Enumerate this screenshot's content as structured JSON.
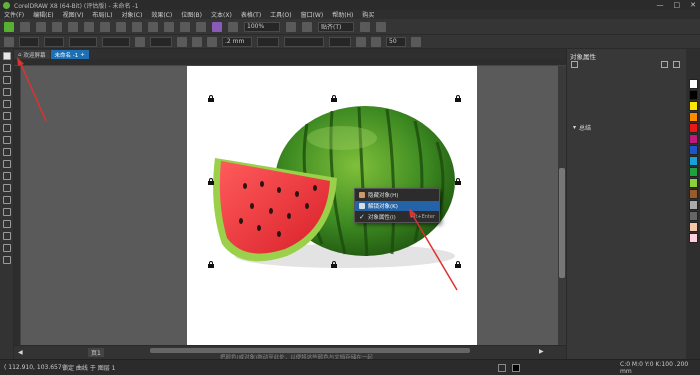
{
  "window": {
    "title": "CorelDRAW X8 (64-Bit) (评估版) - 未命名 -1",
    "controls": [
      "—",
      "□",
      "✕"
    ]
  },
  "menu": [
    "文件(F)",
    "编辑(E)",
    "视图(V)",
    "布局(L)",
    "对象(C)",
    "效果(C)",
    "位图(B)",
    "文本(X)",
    "表格(T)",
    "工具(O)",
    "窗口(W)",
    "帮助(H)",
    "购买"
  ],
  "toolbar": {
    "zoom": "100%",
    "snap": "贴齐(T)",
    "outline_width": ".2 mm",
    "size_value": "50"
  },
  "tabs": [
    {
      "label": "欢迎屏幕"
    },
    {
      "label": "未命名 -1"
    }
  ],
  "context_menu": {
    "items": [
      {
        "label": "隐藏对象(H)",
        "shortcut": ""
      },
      {
        "label": "解锁对象(K)",
        "shortcut": ""
      },
      {
        "label": "对象属性(I)",
        "shortcut": "Alt+Enter"
      }
    ]
  },
  "panel": {
    "title": "对象属性",
    "group_label": "总结"
  },
  "page_tab": "页1",
  "status": {
    "coords": "( 112.910, 103.657 )",
    "selection": "锁定 曲线 于 图层 1",
    "fill_info": "C:0 M:0 Y:0 K:100 .200 mm"
  },
  "canvas_hint": "把颜色(或对象)拖动至此处，以便将这些颜色与文档存储在一起",
  "palette": [
    "#ffffff",
    "#000000",
    "#ffe600",
    "#ff8a00",
    "#e81818",
    "#c2187a",
    "#2255c4",
    "#1aa0d8",
    "#20a040",
    "#8dd13a",
    "#9a5a2a",
    "#aaaaaa",
    "#666666",
    "#f4c7a8",
    "#ffd1dc"
  ]
}
